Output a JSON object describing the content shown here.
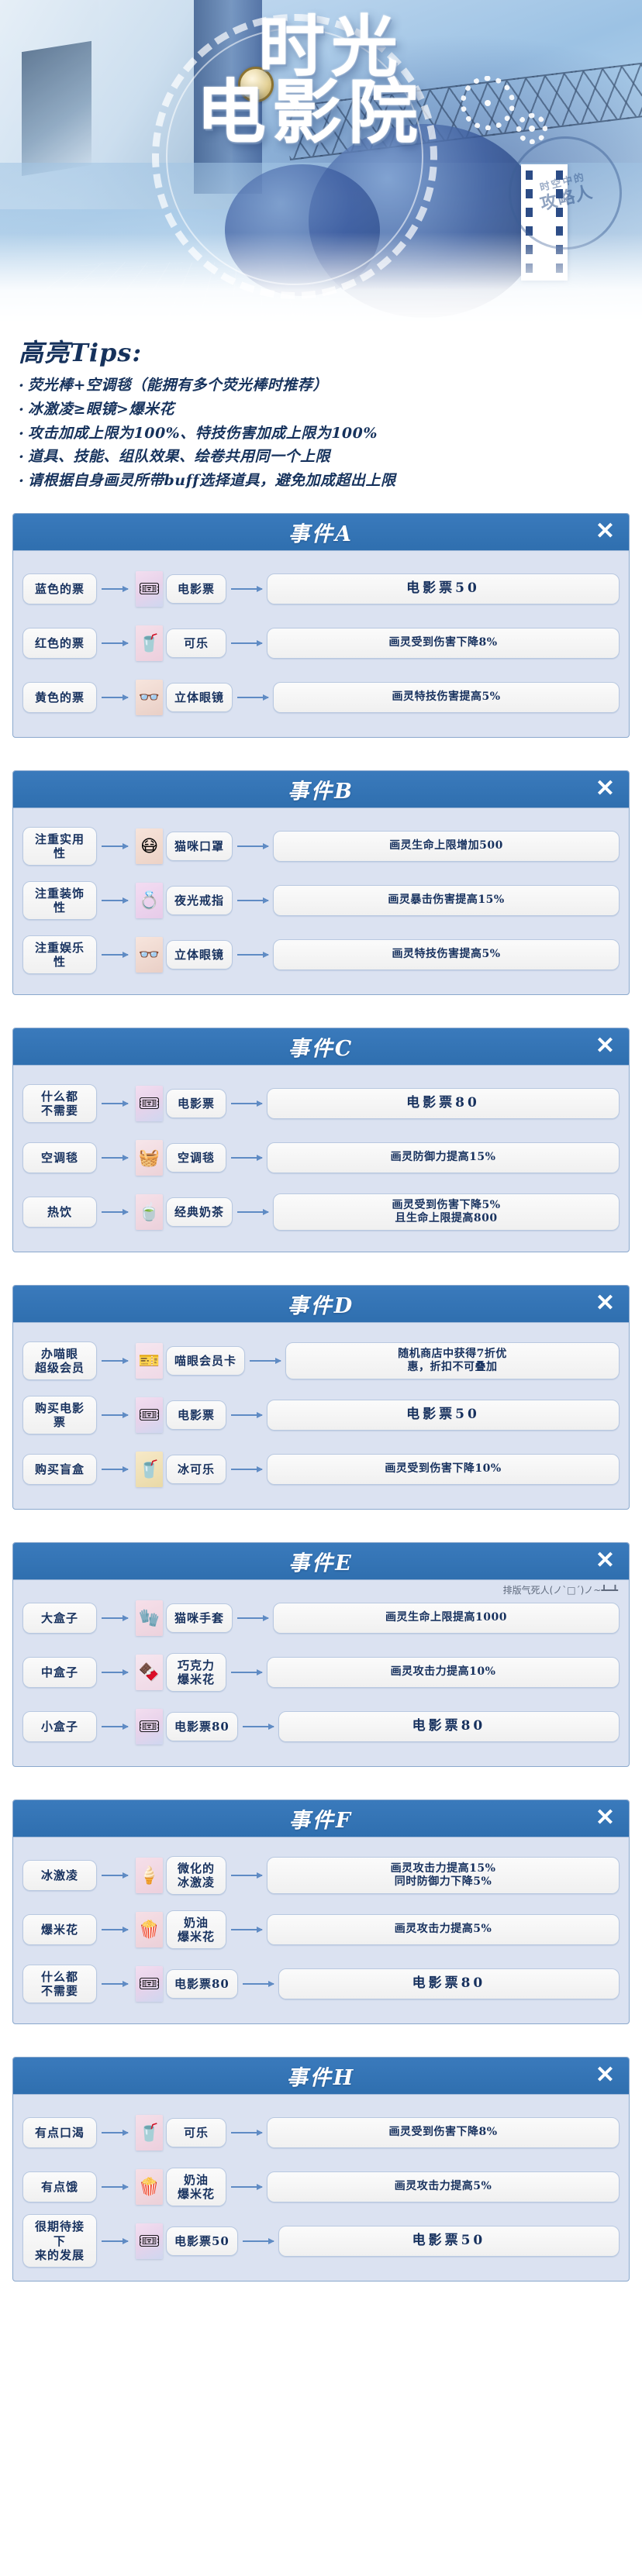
{
  "hero": {
    "title_line1": "时光",
    "title_line2": "电影院",
    "seal_small": "时空中的",
    "seal_main": "攻略人"
  },
  "tips": {
    "title": "高亮Tips:",
    "items": [
      "荧光棒+空调毯（能拥有多个荧光棒时推荐）",
      "冰激凌≥眼镜>爆米花",
      "攻击加成上限为100%、特技伤害加成上限为100%",
      "道具、技能、组队效果、绘卷共用同一个上限",
      "请根据自身画灵所带buff选择道具，避免加成超出上限"
    ]
  },
  "close_label": "✕",
  "cards": [
    {
      "title": "事件A",
      "rows": [
        {
          "cause": "蓝色的票",
          "item": "电影票",
          "icon": "ticket-icon",
          "glyph": "🎟",
          "effect": "电影票50",
          "big": true
        },
        {
          "cause": "红色的票",
          "item": "可乐",
          "icon": "cola-icon",
          "glyph": "🥤",
          "effect": "画灵受到伤害下降8%",
          "big": false
        },
        {
          "cause": "黄色的票",
          "item": "立体眼镜",
          "icon": "glasses-icon",
          "glyph": "👓",
          "effect": "画灵特技伤害提高5%",
          "big": false
        }
      ]
    },
    {
      "title": "事件B",
      "rows": [
        {
          "cause": "注重实用性",
          "item": "猫咪口罩",
          "icon": "mask-icon",
          "glyph": "😷",
          "effect": "画灵生命上限增加500",
          "big": false
        },
        {
          "cause": "注重装饰性",
          "item": "夜光戒指",
          "icon": "ring-icon",
          "glyph": "💍",
          "effect": "画灵暴击伤害提高15%",
          "big": false
        },
        {
          "cause": "注重娱乐性",
          "item": "立体眼镜",
          "icon": "glasses-icon",
          "glyph": "👓",
          "effect": "画灵特技伤害提高5%",
          "big": false
        }
      ]
    },
    {
      "title": "事件C",
      "rows": [
        {
          "cause": "什么都\n不需要",
          "item": "电影票",
          "icon": "ticket-icon",
          "glyph": "🎟",
          "effect": "电影票80",
          "big": true
        },
        {
          "cause": "空调毯",
          "item": "空调毯",
          "icon": "blanket-icon",
          "glyph": "🧺",
          "effect": "画灵防御力提高15%",
          "big": false
        },
        {
          "cause": "热饮",
          "item": "经典奶茶",
          "icon": "milktea-icon",
          "glyph": "🍵",
          "effect": "画灵受到伤害下降5%\n且生命上限提高800",
          "big": false
        }
      ]
    },
    {
      "title": "事件D",
      "rows": [
        {
          "cause": "办喵眼\n超级会员",
          "item": "喵眼会员卡",
          "icon": "membership-card-icon",
          "glyph": "🎫",
          "effect": "随机商店中获得7折优\n惠，折扣不可叠加",
          "big": false
        },
        {
          "cause": "购买电影票",
          "item": "电影票",
          "icon": "ticket-icon",
          "glyph": "🎟",
          "effect": "电影票50",
          "big": true
        },
        {
          "cause": "购买盲盒",
          "item": "冰可乐",
          "icon": "ice-cola-icon",
          "glyph": "🥤",
          "effect": "画灵受到伤害下降10%",
          "big": false
        }
      ]
    },
    {
      "title": "事件E",
      "annotation": "排版气死人(ノ`□´)ノ~┻━┻",
      "rows": [
        {
          "cause": "大盒子",
          "item": "猫咪手套",
          "icon": "gloves-icon",
          "glyph": "🧤",
          "effect": "画灵生命上限提高1000",
          "big": false
        },
        {
          "cause": "中盒子",
          "item": "巧克力\n爆米花",
          "icon": "chocolate-popcorn-icon",
          "glyph": "🍫",
          "effect": "画灵攻击力提高10%",
          "big": false
        },
        {
          "cause": "小盒子",
          "item": "电影票80",
          "icon": "ticket-icon",
          "glyph": "🎟",
          "effect": "电影票80",
          "big": true
        }
      ]
    },
    {
      "title": "事件F",
      "rows": [
        {
          "cause": "冰激凌",
          "item": "微化的\n冰激凌",
          "icon": "icecream-icon",
          "glyph": "🍦",
          "effect": "画灵攻击力提高15%\n同时防御力下降5%",
          "big": false
        },
        {
          "cause": "爆米花",
          "item": "奶油\n爆米花",
          "icon": "popcorn-icon",
          "glyph": "🍿",
          "effect": "画灵攻击力提高5%",
          "big": false
        },
        {
          "cause": "什么都\n不需要",
          "item": "电影票80",
          "icon": "ticket-icon",
          "glyph": "🎟",
          "effect": "电影票80",
          "big": true
        }
      ]
    },
    {
      "title": "事件H",
      "rows": [
        {
          "cause": "有点口渴",
          "item": "可乐",
          "icon": "cola-icon",
          "glyph": "🥤",
          "effect": "画灵受到伤害下降8%",
          "big": false
        },
        {
          "cause": "有点饿",
          "item": "奶油\n爆米花",
          "icon": "popcorn-icon",
          "glyph": "🍿",
          "effect": "画灵攻击力提高5%",
          "big": false
        },
        {
          "cause": "很期待接下\n来的发展",
          "item": "电影票50",
          "icon": "ticket-icon",
          "glyph": "🎟",
          "effect": "电影票50",
          "big": true
        }
      ]
    }
  ]
}
